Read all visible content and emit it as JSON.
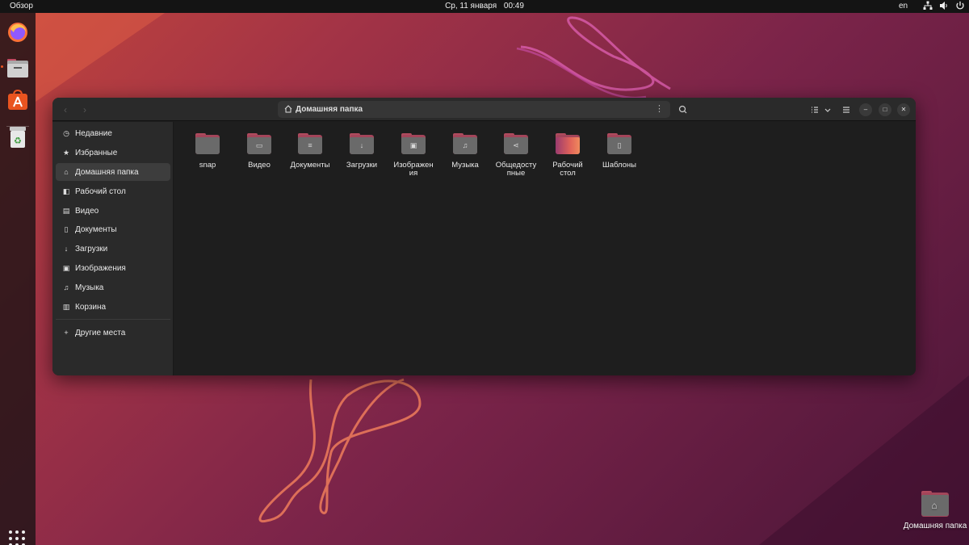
{
  "topbar": {
    "overview": "Обзор",
    "date": "Ср, 11 января",
    "time": "00:49",
    "lang": "en"
  },
  "dock": {
    "items": [
      {
        "name": "Firefox",
        "icon": "firefox-icon"
      },
      {
        "name": "Files",
        "icon": "files-icon",
        "running": true
      },
      {
        "name": "Ubuntu Software",
        "icon": "software-store-icon"
      },
      {
        "name": "Trash",
        "icon": "trash-icon"
      }
    ],
    "show_apps_icon": "apps-grid-icon"
  },
  "window": {
    "path_label": "Домашняя папка",
    "sidebar": {
      "items": [
        {
          "label": "Недавние",
          "icon": "clock-icon"
        },
        {
          "label": "Избранные",
          "icon": "star-icon"
        },
        {
          "label": "Домашняя папка",
          "icon": "home-icon",
          "active": true
        },
        {
          "label": "Рабочий стол",
          "icon": "desktop-icon"
        },
        {
          "label": "Видео",
          "icon": "video-icon"
        },
        {
          "label": "Документы",
          "icon": "document-icon"
        },
        {
          "label": "Загрузки",
          "icon": "download-icon"
        },
        {
          "label": "Изображения",
          "icon": "image-icon"
        },
        {
          "label": "Музыка",
          "icon": "music-icon"
        },
        {
          "label": "Корзина",
          "icon": "trash-icon"
        }
      ],
      "other_places": "Другие места"
    },
    "files": [
      {
        "line1": "snap",
        "line2": "",
        "emblem": ""
      },
      {
        "line1": "Видео",
        "line2": "",
        "emblem": "▭"
      },
      {
        "line1": "Документы",
        "line2": "",
        "emblem": "≡"
      },
      {
        "line1": "Загрузки",
        "line2": "",
        "emblem": "↓"
      },
      {
        "line1": "Изображен",
        "line2": "ия",
        "emblem": "▣"
      },
      {
        "line1": "Музыка",
        "line2": "",
        "emblem": "♫"
      },
      {
        "line1": "Общедосту",
        "line2": "пные",
        "emblem": "⋖"
      },
      {
        "line1": "Рабочий",
        "line2": "стол",
        "emblem": ""
      },
      {
        "line1": "Шаблоны",
        "line2": "",
        "emblem": "▯"
      }
    ]
  },
  "desktop": {
    "home_icon_label": "Домашняя папка"
  },
  "colors": {
    "accent": "#e95420",
    "folder_tab": "#a3455a",
    "window_bg": "#1e1e1e"
  }
}
